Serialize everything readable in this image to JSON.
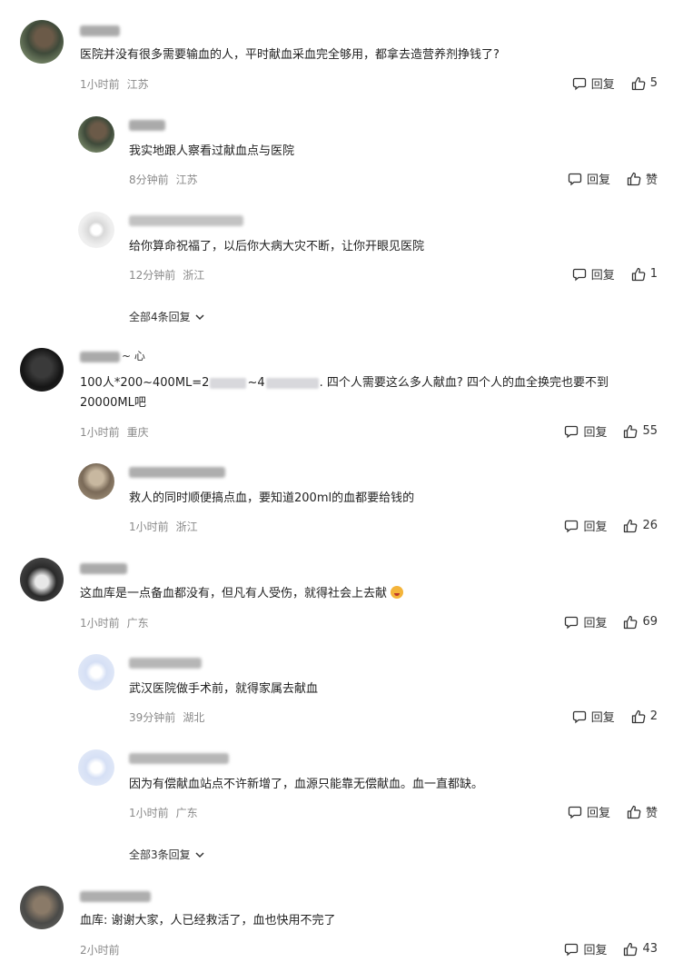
{
  "comments": [
    {
      "text": "医院并没有很多需要输血的人，平时献血采血完全够用，都拿去造营养剂挣钱了?",
      "time": "1小时前",
      "location": "江苏",
      "reply_label": "回复",
      "like_label": "5",
      "replies": [
        {
          "text": "我实地跟人察看过献血点与医院",
          "time": "8分钟前",
          "location": "江苏",
          "reply_label": "回复",
          "like_label": "赞"
        },
        {
          "text": "给你算命祝福了，以后你大病大灾不断，让你开眼见医院",
          "time": "12分钟前",
          "location": "浙江",
          "reply_label": "回复",
          "like_label": "1"
        }
      ],
      "expand_label": "全部4条回复"
    },
    {
      "text_line1_a": "100人*200~400ML=2",
      "text_line1_b": "~4",
      "text_line1_c": ". 四个人需要这么多人献血? 四个人的血全换完也要不到",
      "text_line2": "20000ML吧",
      "name_suffix": "~ 心",
      "time": "1小时前",
      "location": "重庆",
      "reply_label": "回复",
      "like_label": "55",
      "replies": [
        {
          "text": "救人的同时顺便搞点血，要知道200ml的血都要给钱的",
          "time": "1小时前",
          "location": "浙江",
          "reply_label": "回复",
          "like_label": "26"
        }
      ]
    },
    {
      "text": "这血库是一点备血都没有，但凡有人受伤，就得社会上去献",
      "time": "1小时前",
      "location": "广东",
      "reply_label": "回复",
      "like_label": "69",
      "replies": [
        {
          "text": "武汉医院做手术前，就得家属去献血",
          "time": "39分钟前",
          "location": "湖北",
          "reply_label": "回复",
          "like_label": "2"
        },
        {
          "text": "因为有偿献血站点不许新增了，血源只能靠无偿献血。血一直都缺。",
          "time": "1小时前",
          "location": "广东",
          "reply_label": "回复",
          "like_label": "赞"
        }
      ],
      "expand_label": "全部3条回复"
    },
    {
      "text": "血库: 谢谢大家，人已经救活了，血也快用不完了",
      "time": "2小时前",
      "location": "",
      "reply_label": "回复",
      "like_label": "43",
      "replies": []
    }
  ],
  "icons": {
    "reply": "comment-bubble-icon",
    "like": "thumbs-up-icon",
    "expand": "chevron-down-icon"
  },
  "colors": {
    "meta": "#8a8a8a",
    "text": "#222222"
  }
}
